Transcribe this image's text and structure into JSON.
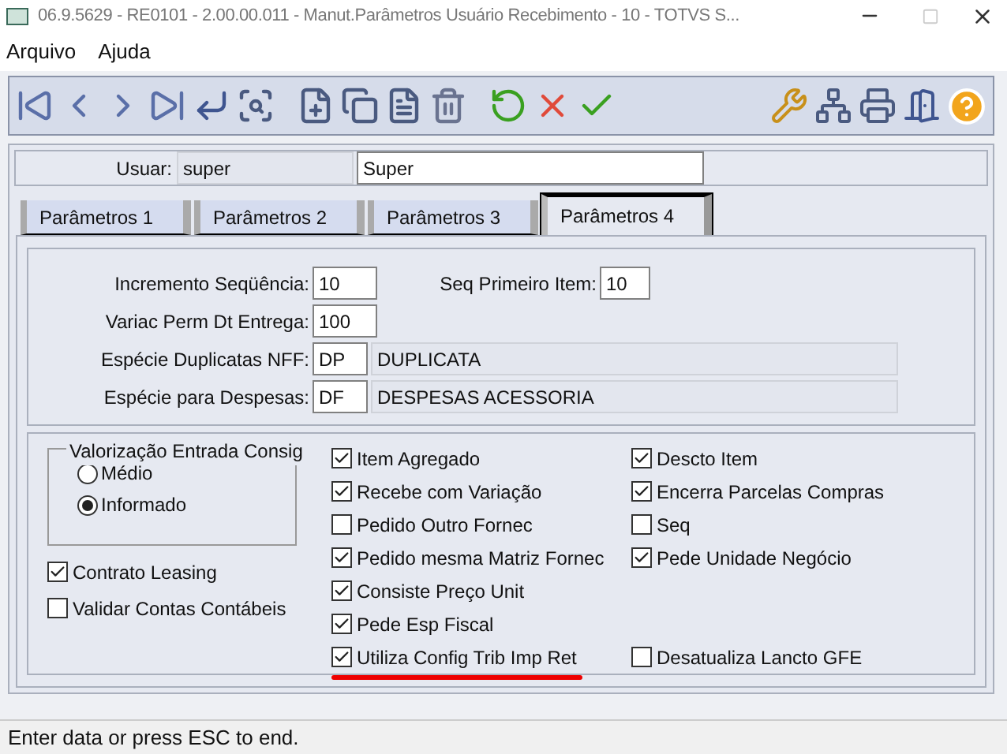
{
  "window": {
    "title": "06.9.5629 - RE0101 - 2.00.00.011 - Manut.Parâmetros Usuário Recebimento - 10 - TOTVS S..."
  },
  "menu": [
    "Arquivo",
    "Ajuda"
  ],
  "user": {
    "label": "Usuar:",
    "code": "super",
    "name": "Super"
  },
  "tabs": [
    {
      "label": "Parâmetros 1",
      "selected": false
    },
    {
      "label": "Parâmetros 2",
      "selected": false
    },
    {
      "label": "Parâmetros 3",
      "selected": false
    },
    {
      "label": "Parâmetros 4",
      "selected": true
    }
  ],
  "fields": {
    "incremento": {
      "label": "Incremento Seqüência:",
      "value": "10"
    },
    "seq_primeiro": {
      "label": "Seq Primeiro Item:",
      "value": "10"
    },
    "variac": {
      "label": "Variac Perm Dt Entrega:",
      "value": "100"
    },
    "especie_dup": {
      "label": "Espécie Duplicatas NFF:",
      "value": "DP",
      "description": "DUPLICATA"
    },
    "especie_desp": {
      "label": "Espécie para Despesas:",
      "value": "DF",
      "description": "DESPESAS ACESSORIA"
    }
  },
  "valorizacao": {
    "title": "Valorização Entrada Consig",
    "options": [
      {
        "label": "Médio",
        "selected": false
      },
      {
        "label": "Informado",
        "selected": true
      }
    ]
  },
  "left_checks": [
    {
      "label": "Contrato Leasing",
      "checked": true
    },
    {
      "label": "Validar Contas Contábeis",
      "checked": false
    }
  ],
  "middle_checks": [
    {
      "label": "Item Agregado",
      "checked": true,
      "underlined": false
    },
    {
      "label": "Recebe com Variação",
      "checked": true,
      "underlined": false
    },
    {
      "label": "Pedido Outro Fornec",
      "checked": false,
      "underlined": false
    },
    {
      "label": "Pedido mesma Matriz Fornec",
      "checked": true,
      "underlined": false
    },
    {
      "label": "Consiste Preço Unit",
      "checked": true,
      "underlined": false
    },
    {
      "label": "Pede Esp Fiscal",
      "checked": true,
      "underlined": false
    },
    {
      "label": "Utiliza Config Trib Imp Ret",
      "checked": true,
      "underlined": true
    }
  ],
  "right_checks": [
    {
      "label": "Descto Item",
      "checked": true
    },
    {
      "label": "Encerra Parcelas Compras",
      "checked": true
    },
    {
      "label": "Seq",
      "checked": false
    },
    {
      "label": "Pede Unidade Negócio",
      "checked": true
    },
    {
      "label": "Desatualiza Lancto GFE",
      "checked": false
    }
  ],
  "status_bar": "Enter data or press ESC to end."
}
